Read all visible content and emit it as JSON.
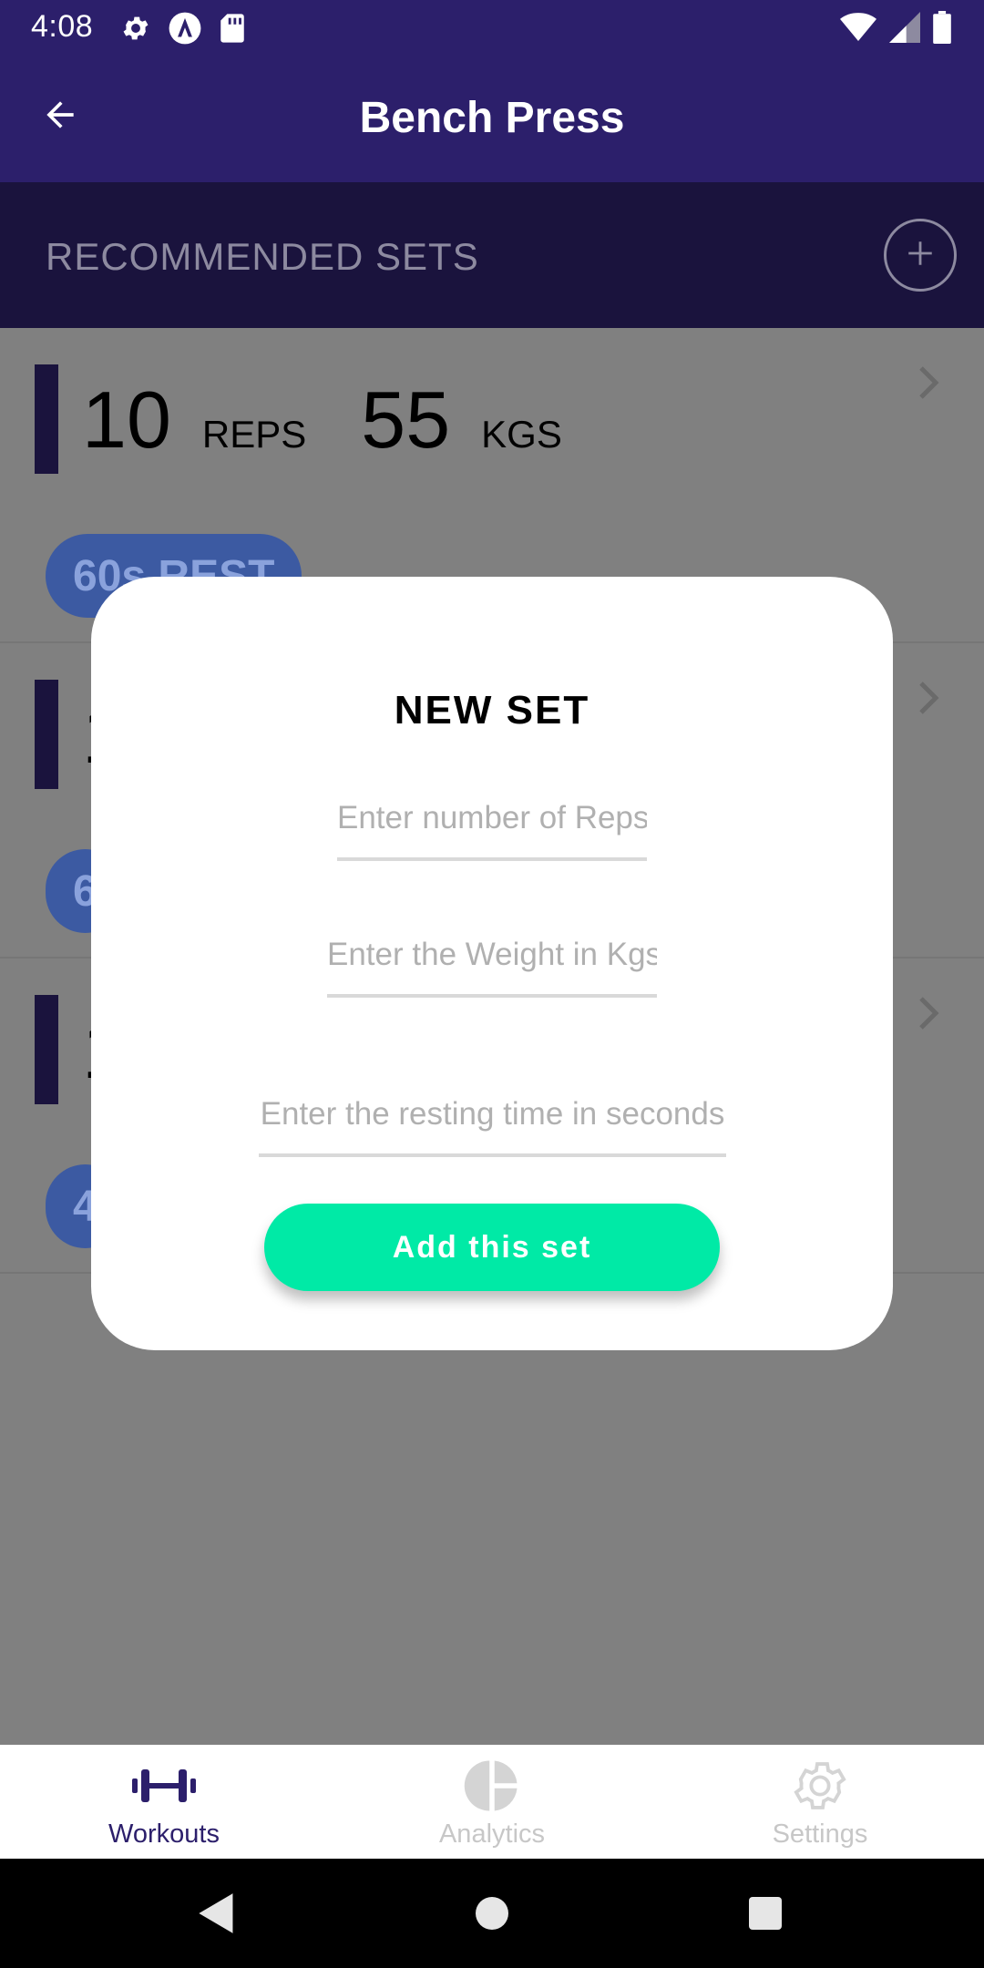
{
  "status_bar": {
    "time": "4:08",
    "left_icons": [
      "settings-icon",
      "navigation-a-icon",
      "sd-card-icon"
    ],
    "right_icons": [
      "wifi-icon",
      "cell-signal-icon",
      "battery-icon"
    ]
  },
  "app_bar": {
    "title": "Bench Press",
    "back_icon": "arrow-back-icon"
  },
  "section": {
    "title": "RECOMMENDED SETS",
    "add_icon": "plus-circle-icon"
  },
  "sets": [
    {
      "reps": "10",
      "reps_unit": "REPS",
      "weight": "55",
      "weight_unit": "KGS",
      "rest": "60s REST"
    },
    {
      "reps": "1",
      "reps_unit": "",
      "weight": "",
      "weight_unit": "",
      "rest": "6"
    },
    {
      "reps": "1",
      "reps_unit": "",
      "weight": "",
      "weight_unit": "",
      "rest": "4"
    }
  ],
  "dialog": {
    "title": "NEW SET",
    "reps_placeholder": "Enter number of Reps",
    "weight_placeholder": "Enter the Weight in Kgs",
    "rest_placeholder": "Enter the resting time in seconds",
    "submit_label": "Add this set"
  },
  "bottom_nav": {
    "items": [
      {
        "label": "Workouts",
        "icon": "dumbbell-icon",
        "active": true
      },
      {
        "label": "Analytics",
        "icon": "pie-chart-icon",
        "active": false
      },
      {
        "label": "Settings",
        "icon": "gear-icon",
        "active": false
      }
    ]
  },
  "colors": {
    "primary": "#2c1f6b",
    "primary_dark": "#1a133d",
    "accent": "#00eaa6",
    "rest_pill": "#3c5aa2"
  }
}
